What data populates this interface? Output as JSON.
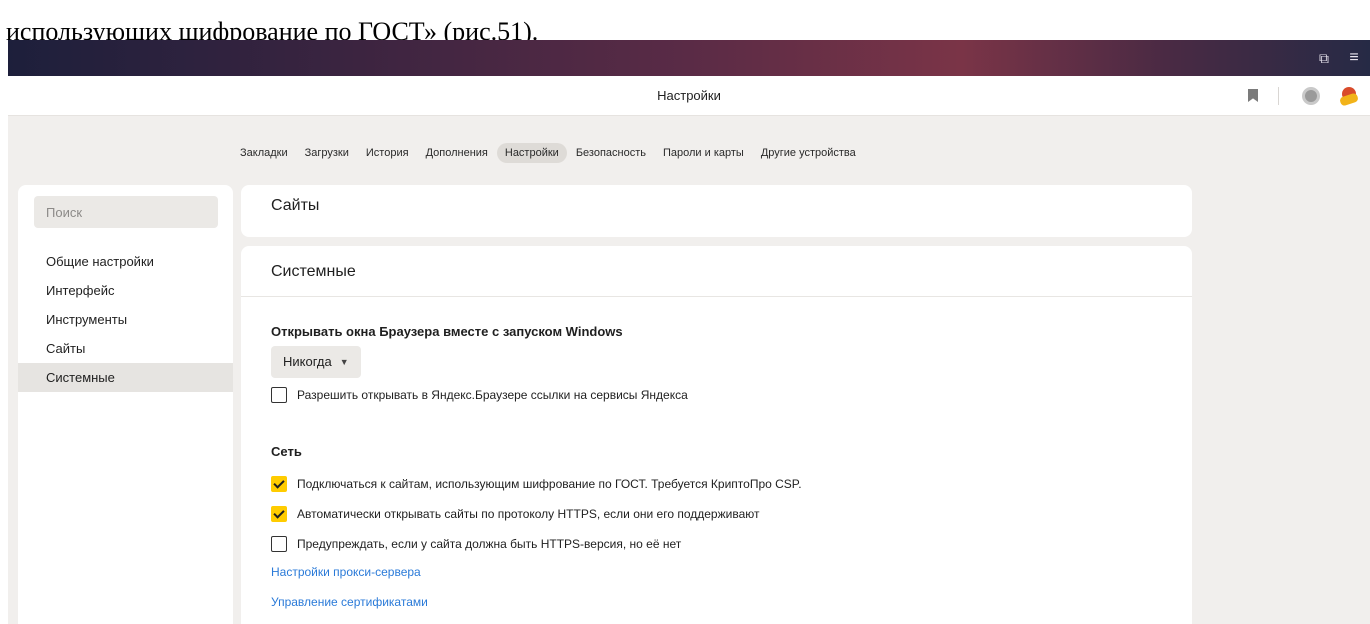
{
  "document": {
    "caption": "использующих шифрование по ГОСТ» (рис.51)."
  },
  "titlebar": {
    "copy_icon": "⧉",
    "menu_icon": "≡"
  },
  "header": {
    "title": "Настройки"
  },
  "tabs": [
    {
      "label": "Закладки",
      "active": false
    },
    {
      "label": "Загрузки",
      "active": false
    },
    {
      "label": "История",
      "active": false
    },
    {
      "label": "Дополнения",
      "active": false
    },
    {
      "label": "Настройки",
      "active": true
    },
    {
      "label": "Безопасность",
      "active": false
    },
    {
      "label": "Пароли и карты",
      "active": false
    },
    {
      "label": "Другие устройства",
      "active": false
    }
  ],
  "sidebar": {
    "search_placeholder": "Поиск",
    "items": [
      {
        "label": "Общие настройки",
        "active": false
      },
      {
        "label": "Интерфейс",
        "active": false
      },
      {
        "label": "Инструменты",
        "active": false
      },
      {
        "label": "Сайты",
        "active": false
      },
      {
        "label": "Системные",
        "active": true
      }
    ]
  },
  "main": {
    "sites_title": "Сайты",
    "system_title": "Системные",
    "startup": {
      "heading": "Открывать окна Браузера вместе с запуском Windows",
      "dropdown_value": "Никогда",
      "open_yandex_links": {
        "label": "Разрешить открывать в Яндекс.Браузере ссылки на сервисы Яндекса",
        "checked": false
      }
    },
    "network": {
      "heading": "Сеть",
      "gost": {
        "label": "Подключаться к сайтам, использующим шифрование по ГОСТ. Требуется КриптоПро CSP.",
        "checked": true
      },
      "https_auto": {
        "label": "Автоматически открывать сайты по протоколу HTTPS, если они его поддерживают",
        "checked": true
      },
      "https_warn": {
        "label": "Предупреждать, если у сайта должна быть HTTPS-версия, но её нет",
        "checked": false
      },
      "proxy_link": "Настройки прокси-сервера",
      "certs_link": "Управление сертификатами"
    }
  },
  "colors": {
    "accent_checkbox": "#ffcc00",
    "link": "#2a7ad8"
  }
}
